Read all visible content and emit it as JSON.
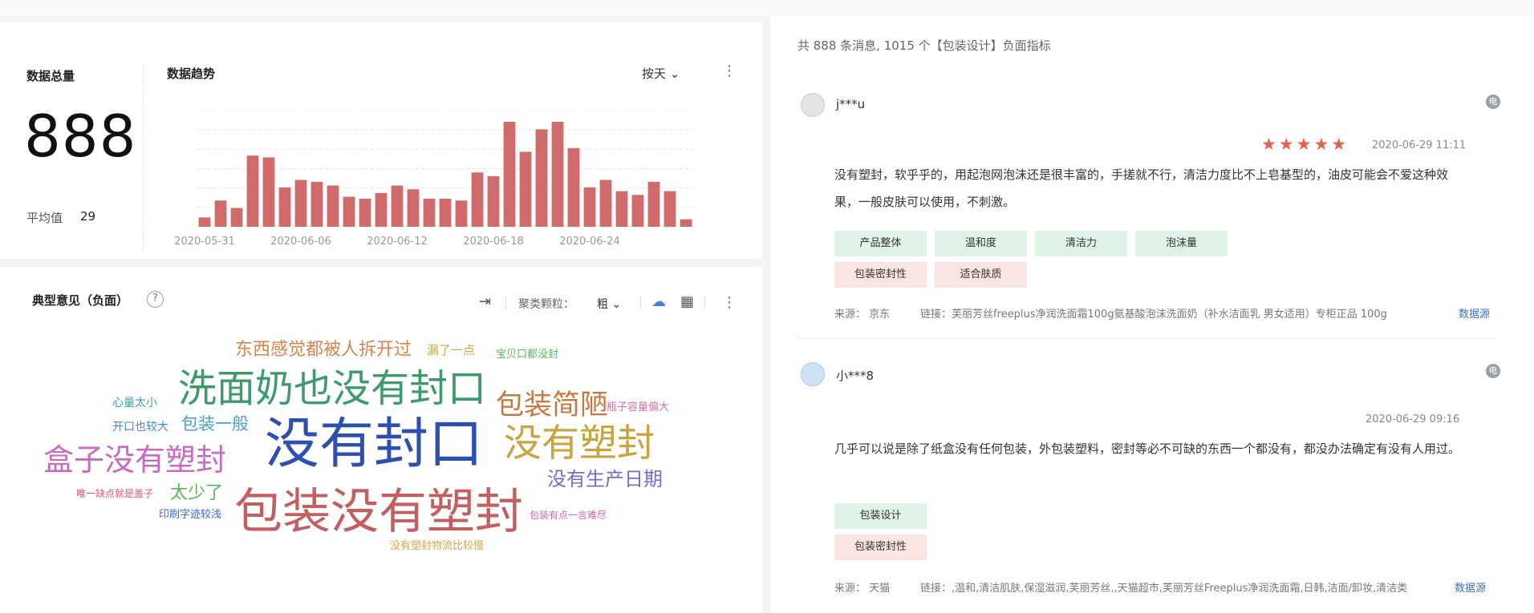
{
  "kpi": {
    "title": "数据总量",
    "value": "888",
    "avg_label": "平均值",
    "avg_value": "29"
  },
  "trend": {
    "title": "数据趋势",
    "period_select": "按天 ⌄"
  },
  "chart_data": {
    "type": "bar",
    "title": "数据趋势",
    "x_tick_labels": [
      "2020-05-31",
      "2020-06-06",
      "2020-06-12",
      "2020-06-18",
      "2020-06-24"
    ],
    "series": [
      {
        "values": [
          5,
          14,
          10,
          38,
          37,
          21,
          25,
          24,
          22,
          16,
          15,
          18,
          22,
          20,
          15,
          15,
          14,
          29,
          27,
          56,
          40,
          52,
          56,
          42,
          21,
          25,
          19,
          17,
          24,
          19,
          4
        ]
      }
    ],
    "ylim": [
      0,
      62
    ],
    "grid": true,
    "color": "#d06b6b"
  },
  "cloud": {
    "title": "典型意见（负面）",
    "help": "?",
    "granularity_label": "聚类颗粒：",
    "granularity_value": "粗 ⌄",
    "words": [
      {
        "text": "东西感觉都被人拆开过",
        "color": "#d9844e"
      },
      {
        "text": "漏了一点",
        "color": "#c9a94a"
      },
      {
        "text": "宝贝口都没封",
        "color": "#5cb85c"
      },
      {
        "text": "洗面奶也没有封口",
        "color": "#3d9a6b"
      },
      {
        "text": "包装简陋",
        "color": "#c9783f"
      },
      {
        "text": "心量太小",
        "color": "#3aa0a0"
      },
      {
        "text": "瓶子容量偏大",
        "color": "#cf6fae"
      },
      {
        "text": "开口也较大",
        "color": "#3e8ad1"
      },
      {
        "text": "包装一般",
        "color": "#4a9fd4"
      },
      {
        "text": "没有封口",
        "color": "#2d4fb0"
      },
      {
        "text": "没有塑封",
        "color": "#c7a43e"
      },
      {
        "text": "盒子没有塑封",
        "color": "#c76bc2"
      },
      {
        "text": "没有生产日期",
        "color": "#6f6fc9"
      },
      {
        "text": "太少了",
        "color": "#5bb55b"
      },
      {
        "text": "唯一缺点就是盖子",
        "color": "#d35a7a"
      },
      {
        "text": "包装没有塑封",
        "color": "#c45f5f"
      },
      {
        "text": "印刷字迹较浅",
        "color": "#3d6ad1"
      },
      {
        "text": "包装有点一言难尽",
        "color": "#c968b8"
      },
      {
        "text": "没有塑封物流比较慢",
        "color": "#d9a54a"
      }
    ],
    "colors": {
      "accent": "#4a7fe0"
    }
  },
  "reviews_panel": {
    "summary": "共 888 条消息,  1015 个【包装设计】负面指标",
    "reviews": [
      {
        "username": "j***u",
        "icon": "电",
        "rating": 5,
        "stars": "★★★★★",
        "timestamp": "2020-06-29 11:11",
        "text": "没有塑封，软乎乎的，用起泡网泡沫还是很丰富的，手搓就不行，清洁力度比不上皂基型的，油皮可能会不爱这种效果，一般皮肤可以使用，不刺激。",
        "tags_green": [
          "产品整体",
          "温和度",
          "清洁力",
          "泡沫量"
        ],
        "tags_pink": [
          "包装密封性",
          "适合肤质"
        ],
        "source": "来源：  京东",
        "link": "链接：芙丽芳丝freeplus净润洗面霜100g氨基酸泡沫洗面奶（补水洁面乳 男女适用）专柜正品 100g",
        "link_action": "数据源"
      },
      {
        "username": "小***8",
        "icon": "电",
        "timestamp": "2020-06-29 09:16",
        "text": "几乎可以说是除了纸盒没有任何包装，外包装塑料，密封等必不可缺的东西一个都没有，都没办法确定有没有人用过。",
        "tags_green": [
          "包装设计"
        ],
        "tags_pink": [
          "包装密封性"
        ],
        "source": "来源：  天猫",
        "link": "链接：,温和,清洁肌肤,保湿滋润,芙丽芳丝,,天猫超市,芙丽芳丝Freeplus净润洗面霜,日韩,洁面/卸妆,清洁类",
        "link_action": "数据源"
      }
    ]
  }
}
